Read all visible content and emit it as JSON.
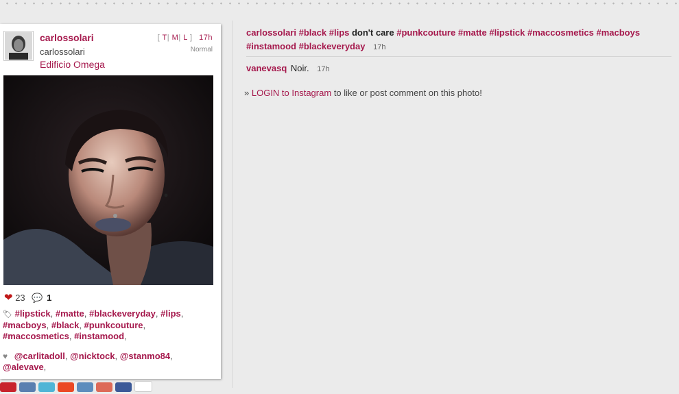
{
  "post": {
    "username": "carlossolari",
    "full_name": "carlossolari",
    "location": "Edificio Omega",
    "sizes": [
      "T",
      "M",
      "L"
    ],
    "time": "17h",
    "filter": "Normal",
    "likes": "23",
    "comments": "1",
    "tags": [
      "#lipstick",
      "#matte",
      "#blackeveryday",
      "#lips",
      "#macboys",
      "#black",
      "#punkcouture",
      "#maccosmetics",
      "#instamood"
    ],
    "liked_by": [
      "@carlitadoll",
      "@nicktock",
      "@stanmo84",
      "@alevave"
    ]
  },
  "caption": {
    "user": "carlossolari",
    "tags_before": [
      "#black",
      "#lips"
    ],
    "plain": "don't care",
    "tags_after": [
      "#punkcouture",
      "#matte",
      "#lipstick",
      "#maccosmetics",
      "#macboys",
      "#instamood",
      "#blackeveryday"
    ],
    "time": "17h"
  },
  "comment": {
    "user": "vanevasq",
    "text": "Noir.",
    "time": "17h"
  },
  "login": {
    "prefix": "»",
    "link": "LOGIN to Instagram",
    "suffix": "to like or post comment on this photo!"
  },
  "colors": {
    "accent": "#a5184c",
    "heart": "#c01a1a",
    "comment_bubble": "#2a9fa4",
    "background": "#ebebeb"
  },
  "share_buttons": [
    {
      "name": "pinterest-share-icon",
      "color": "#c8232c"
    },
    {
      "name": "digg-share-icon",
      "color": "#5a7fb0"
    },
    {
      "name": "twitter-share-icon",
      "color": "#4fb5d6"
    },
    {
      "name": "stumbleupon-share-icon",
      "color": "#eb4924"
    },
    {
      "name": "linkedin-share-icon",
      "color": "#5d8dbd"
    },
    {
      "name": "google-share-icon",
      "color": "#dd6a58"
    },
    {
      "name": "facebook-share-icon",
      "color": "#3b5998"
    },
    {
      "name": "more-share-icon",
      "color": "#ffffff"
    }
  ]
}
